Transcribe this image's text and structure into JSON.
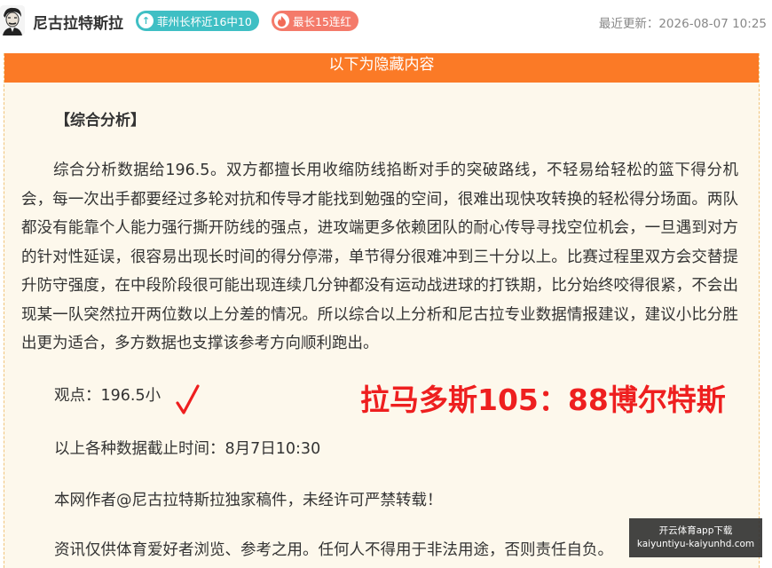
{
  "header": {
    "author_name": "尼古拉特斯拉",
    "badge_streak_recent": "菲州长杯近16中10",
    "badge_streak_longest": "最长15连红",
    "last_updated": "最近更新：2026-08-07 10:25"
  },
  "hidden_section": {
    "banner": "以下为隐藏内容"
  },
  "article": {
    "section_title": "【综合分析】",
    "body": "综合分析数据给196.5。双方都擅长用收缩防线掐断对手的突破路线，不轻易给轻松的篮下得分机会，每一次出手都要经过多轮对抗和传导才能找到勉强的空间，很难出现快攻转换的轻松得分场面。两队都没有能靠个人能力强行撕开防线的强点，进攻端更多依赖团队的耐心传导寻找空位机会，一旦遇到对方的针对性延误，很容易出现长时间的得分停滞，单节得分很难冲到三十分以上。比赛过程里双方会交替提升防守强度，在中段阶段很可能出现连续几分钟都没有运动战进球的打铁期，比分始终咬得很紧，不会出现某一队突然拉开两位数以上分差的情况。所以综合以上分析和尼古拉专业数据情报建议，建议小比分胜出更为适合，多方数据也支撑该参考方向顺利跑出。",
    "viewpoint": "观点：196.5小",
    "result_score": "拉马多斯105：88博尔特斯",
    "deadline": "以上各种数据截止时间：8月7日10:30",
    "copyright": "本网作者@尼古拉特斯拉独家稿件，未经许可严禁转载！",
    "disclaimer": "资讯仅供体育爱好者浏览、参考之用。任何人不得用于非法用途，否则责任自负。"
  },
  "overlay": {
    "line1": "开云体育app下载",
    "line2": "kaiyuntiyu-kaiyunhd.com"
  },
  "colors": {
    "banner": "#fb7a26",
    "badge_teal": "#3fbfc4",
    "badge_red": "#f47a6a",
    "score_red": "#ee1f1f",
    "box_bg": "#fdf8ec"
  },
  "icons": {
    "avatar": "author-avatar",
    "badge_recent_icon": "up-arrow-icon",
    "badge_longest_icon": "flame-icon",
    "checkmark": "checkmark-icon"
  }
}
